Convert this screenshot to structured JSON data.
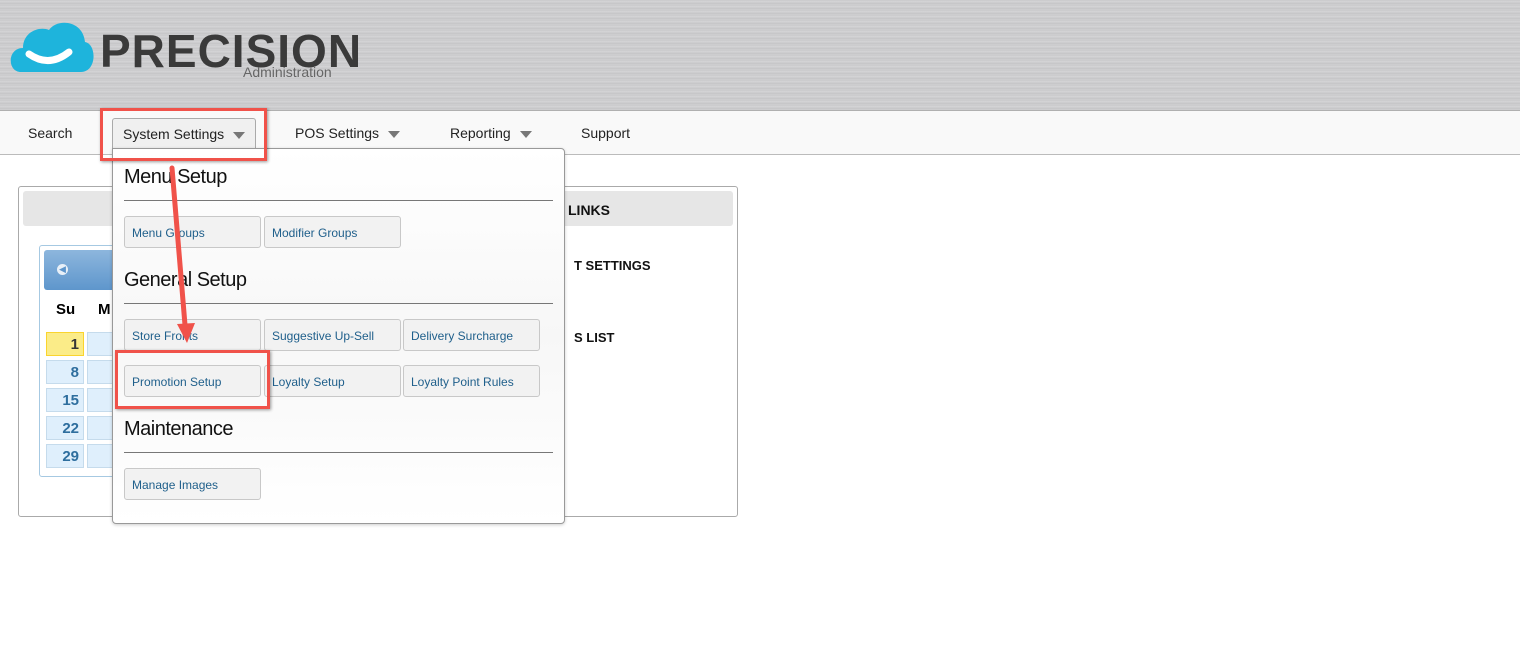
{
  "header": {
    "logo_text": "PRECISION",
    "logo_subtitle": "Administration",
    "brand_color": "#1eb4dc"
  },
  "nav": {
    "items": [
      {
        "label": "Search"
      },
      {
        "label": "System Settings",
        "dropdown": true
      },
      {
        "label": "POS Settings",
        "dropdown": true
      },
      {
        "label": "Reporting",
        "dropdown": true
      },
      {
        "label": "Support"
      }
    ]
  },
  "panel": {
    "links_title": "LINKS",
    "link1": "T SETTINGS",
    "link2": "S LIST"
  },
  "calendar": {
    "dow": [
      "Su",
      "M"
    ],
    "days": [
      "1",
      "8",
      "15",
      "22",
      "29"
    ]
  },
  "dropdown": {
    "sections": [
      {
        "title": "Menu Setup",
        "items": [
          "Menu Groups",
          "Modifier Groups"
        ]
      },
      {
        "title": "General Setup",
        "items": [
          "Store Fronts",
          "Suggestive Up-Sell",
          "Delivery Surcharge",
          "Promotion Setup",
          "Loyalty Setup",
          "Loyalty Point Rules"
        ]
      },
      {
        "title": "Maintenance",
        "items": [
          "Manage Images"
        ]
      }
    ]
  },
  "annotation_color": "#f0524a"
}
